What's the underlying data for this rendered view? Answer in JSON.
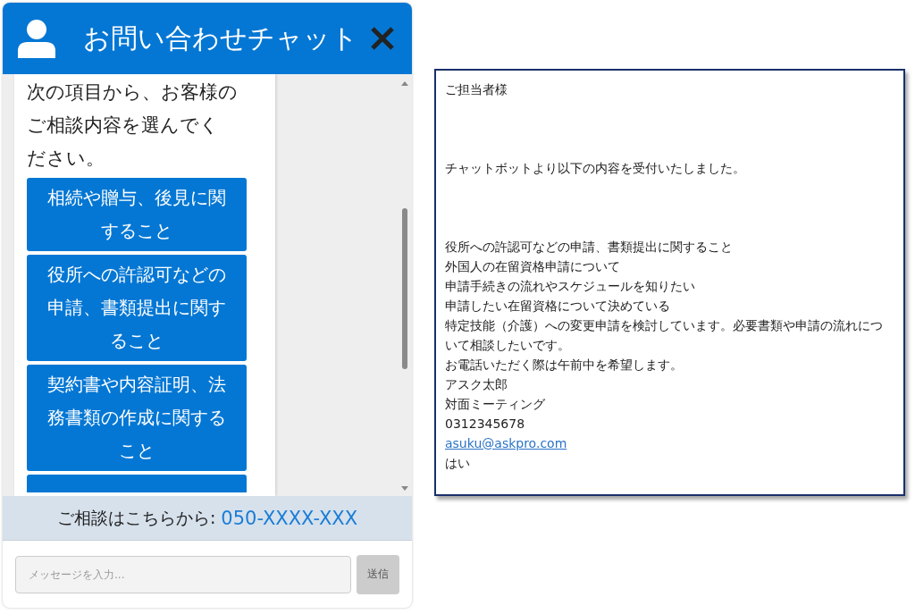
{
  "chat": {
    "title": "お問い合わせチャット",
    "message": "次の項目から、お客様のご相談内容を選んでください。",
    "options": [
      {
        "label": "相続や贈与、後見に関すること"
      },
      {
        "label": "役所への許認可などの申請、書類提出に関すること"
      },
      {
        "label": "契約書や内容証明、法務書類の作成に関すること"
      }
    ],
    "contact_label": "ご相談はこちらから:",
    "contact_phone": "050-XXXX-XXX",
    "input": {
      "placeholder": "メッセージを入力..."
    },
    "send_button": {
      "label": "送信",
      "disabled": true
    }
  },
  "email": {
    "greeting": "ご担当者様",
    "intro": "チャットボットより以下の内容を受付いたしました。",
    "lines": [
      {
        "kind": "text",
        "text": "役所への許認可などの申請、書類提出に関すること"
      },
      {
        "kind": "text",
        "text": "外国人の在留資格申請について"
      },
      {
        "kind": "text",
        "text": "申請手続きの流れやスケジュールを知りたい"
      },
      {
        "kind": "text",
        "text": "申請したい在留資格について決めている"
      },
      {
        "kind": "text",
        "text": "特定技能（介護）への変更申請を検討しています。必要書類や申請の流れについて相談したいです。"
      },
      {
        "kind": "text",
        "text": "お電話いただく際は午前中を希望します。"
      },
      {
        "kind": "text",
        "text": "アスク太郎"
      },
      {
        "kind": "text",
        "text": "対面ミーティング"
      },
      {
        "kind": "text",
        "text": "0312345678"
      },
      {
        "kind": "link",
        "text": "asuku@askpro.com"
      },
      {
        "kind": "text",
        "text": "はい"
      }
    ]
  }
}
